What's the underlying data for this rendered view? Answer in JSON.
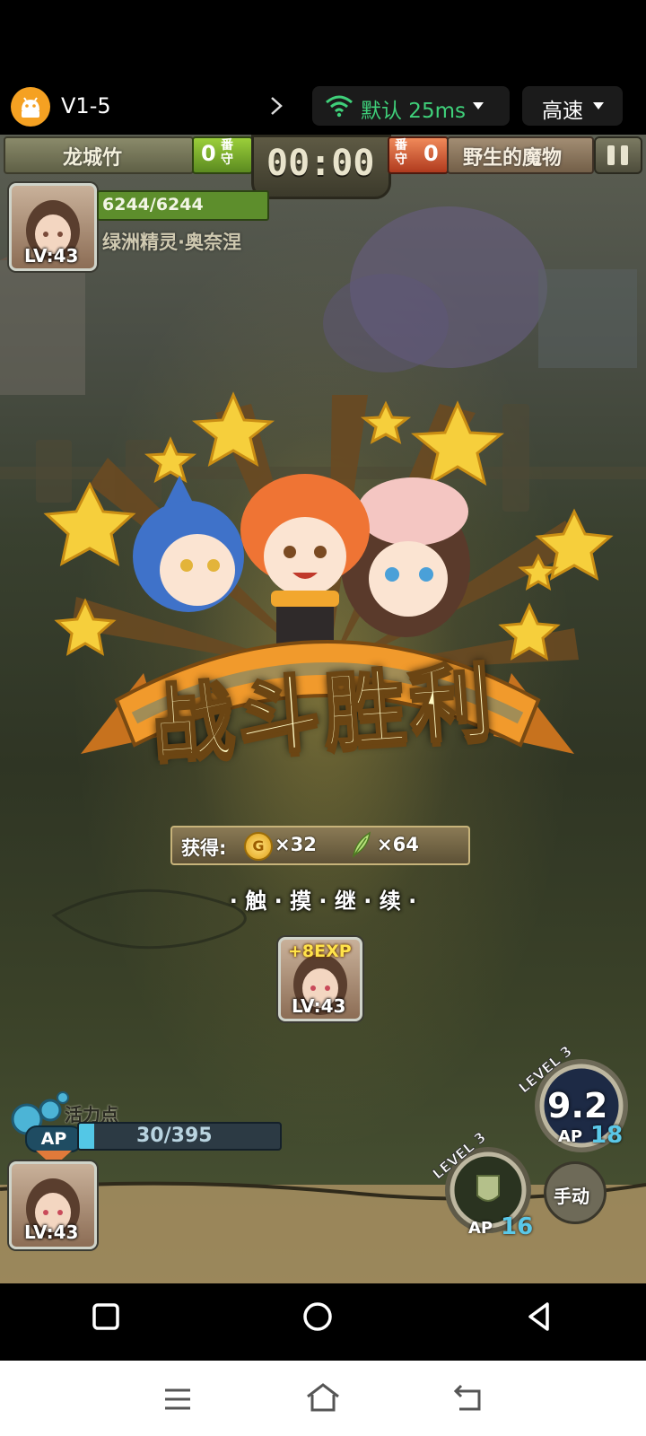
{
  "app_bar": {
    "level_label": "V1-5",
    "network_label": "默认 25ms",
    "speed_label": "高速"
  },
  "battle_header": {
    "player_name": "龙城竹",
    "player_guard_count": "0",
    "player_guard_label": "番守",
    "timer": "00:00",
    "enemy_guard_label": "番守",
    "enemy_guard_count": "0",
    "enemy_name": "野生的魔物"
  },
  "boss": {
    "hp_text": "6244/6244",
    "name": "绿洲精灵·奥奈涅",
    "level": "LV:43"
  },
  "victory": {
    "title": "战斗胜利",
    "reward_label": "获得:",
    "gold_amount": "×32",
    "feather_amount": "×64",
    "continue_text": "· 触 · 摸 · 继 · 续 ·",
    "exp_label": "+8EXP",
    "hero_level": "LV:43"
  },
  "ap_panel": {
    "label": "活力点",
    "ap_short": "AP",
    "value": "30/395",
    "fill_fraction": 0.076
  },
  "bottom_card": {
    "level": "LV:43"
  },
  "skill_big": {
    "level_label": "LEVEL 3",
    "value": "9.2",
    "ap_label": "AP",
    "ap_cost": "18"
  },
  "skill_small": {
    "level_label": "LEVEL 3",
    "ap_label": "AP",
    "ap_cost": "16",
    "mode_label": "手动"
  },
  "colors": {
    "accent_green": "#7cd64a",
    "gold": "#f2c233",
    "ribbon_orange": "#f19a2c"
  }
}
